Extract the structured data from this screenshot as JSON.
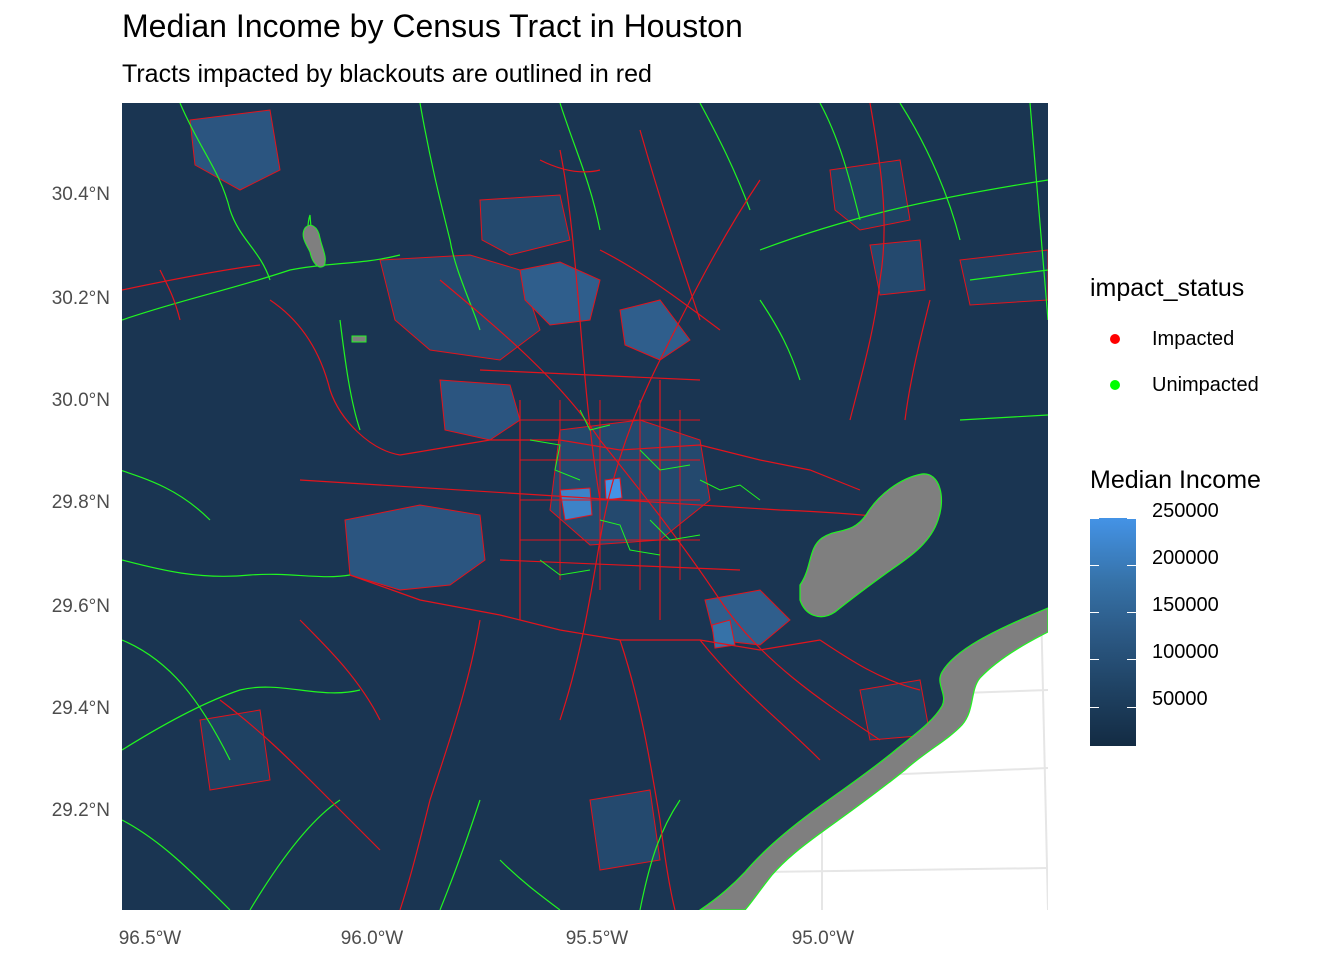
{
  "title": "Median Income by Census Tract in Houston",
  "subtitle": "Tracts impacted by blackouts are outlined in red",
  "map": {
    "x_ticks": [
      "96.5°W",
      "96.0°W",
      "95.5°W",
      "95.0°W"
    ],
    "y_ticks": [
      "30.4°N",
      "30.2°N",
      "30.0°N",
      "29.8°N",
      "29.6°N",
      "29.4°N",
      "29.2°N"
    ],
    "extent": {
      "lon": [
        -96.57,
        -94.45
      ],
      "lat": [
        29.0,
        30.58
      ]
    },
    "colors": {
      "low": "#132b43",
      "high": "#56b1f7",
      "water": "#7f7f7f",
      "impacted_outline": "#e3141c",
      "unimpacted_outline": "#21f521",
      "background": "#ffffff"
    }
  },
  "legend": {
    "impact": {
      "title": "impact_status",
      "items": [
        {
          "label": "Impacted",
          "color": "#ff0000"
        },
        {
          "label": "Unimpacted",
          "color": "#00ff00"
        }
      ]
    },
    "income": {
      "title": "Median Income",
      "ticks": [
        "250000",
        "200000",
        "150000",
        "100000",
        "50000"
      ],
      "values": [
        250000,
        200000,
        150000,
        100000,
        50000
      ],
      "range": [
        10000,
        250000
      ]
    }
  }
}
